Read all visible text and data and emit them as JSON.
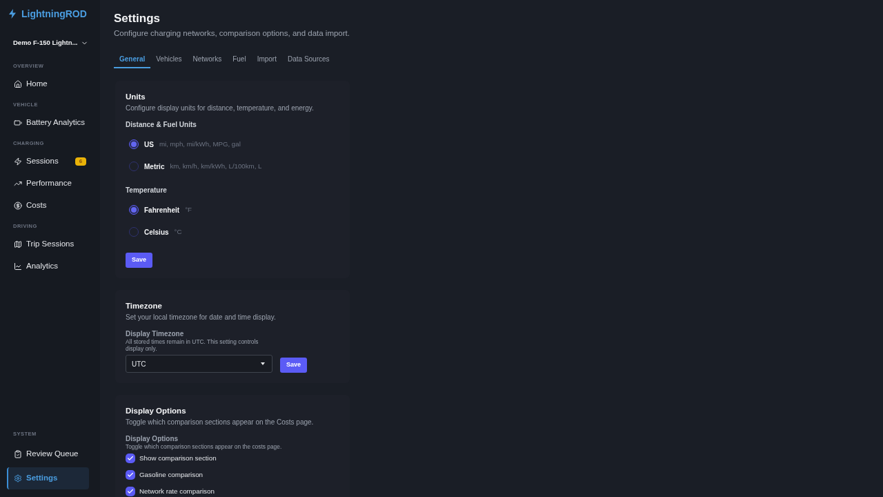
{
  "sidebar": {
    "brand": "LightningROD",
    "vehicle_selector": "Demo F-150 Lightn...",
    "sections": [
      {
        "title": "OVERVIEW",
        "items": [
          {
            "label": "Home",
            "selected": false
          }
        ]
      },
      {
        "title": "VEHICLE",
        "items": [
          {
            "label": "Battery Analytics",
            "selected": false
          }
        ]
      },
      {
        "title": "CHARGING",
        "items": [
          {
            "label": "Sessions",
            "badge": "6",
            "selected": false
          },
          {
            "label": "Performance",
            "selected": false
          },
          {
            "label": "Costs",
            "selected": false
          }
        ]
      },
      {
        "title": "DRIVING",
        "items": [
          {
            "label": "Trip Sessions",
            "selected": false
          },
          {
            "label": "Analytics",
            "selected": false
          }
        ]
      }
    ],
    "footer_section": {
      "title": "SYSTEM",
      "items": [
        {
          "label": "Review Queue",
          "selected": false
        },
        {
          "label": "Settings",
          "selected": true
        }
      ]
    }
  },
  "page": {
    "title": "Settings",
    "subtitle": "Configure charging networks, comparison options, and data import."
  },
  "tabs": [
    {
      "label": "General",
      "selected": true
    },
    {
      "label": "Vehicles",
      "selected": false
    },
    {
      "label": "Networks",
      "selected": false
    },
    {
      "label": "Fuel",
      "selected": false
    },
    {
      "label": "Import",
      "selected": false
    },
    {
      "label": "Data Sources",
      "selected": false
    }
  ],
  "cards": [
    {
      "kind": "radio_groups",
      "title": "Units",
      "description": "Configure display units for distance, temperature, and energy.",
      "groups": [
        {
          "label": "Distance & Fuel Units",
          "options": [
            {
              "label": "US",
              "hint": "mi, mph, mi/kWh, MPG, gal",
              "selected": true
            },
            {
              "label": "Metric",
              "hint": "km, km/h, km/kWh, L/100km, L",
              "selected": false
            }
          ]
        },
        {
          "label": "Temperature",
          "options": [
            {
              "label": "Fahrenheit",
              "hint": "°F",
              "selected": true
            },
            {
              "label": "Celsius",
              "hint": "°C",
              "selected": false
            }
          ]
        }
      ],
      "button": "Save"
    },
    {
      "kind": "select",
      "title": "Timezone",
      "description": "Set your local timezone for date and time display.",
      "field_label": "Display Timezone",
      "field_hint": "All stored times remain in UTC. This setting controls display only.",
      "value": "UTC",
      "button": "Save"
    },
    {
      "kind": "checkboxes",
      "title": "Display Options",
      "description": "Toggle which comparison sections appear on the Costs page.",
      "field_label": "Display Options",
      "field_hint": "Toggle which comparison sections appear on the costs page.",
      "options": [
        {
          "label": "Show comparison section",
          "checked": true
        },
        {
          "label": "Gasoline comparison",
          "checked": true
        },
        {
          "label": "Network rate comparison",
          "checked": true
        }
      ]
    }
  ]
}
